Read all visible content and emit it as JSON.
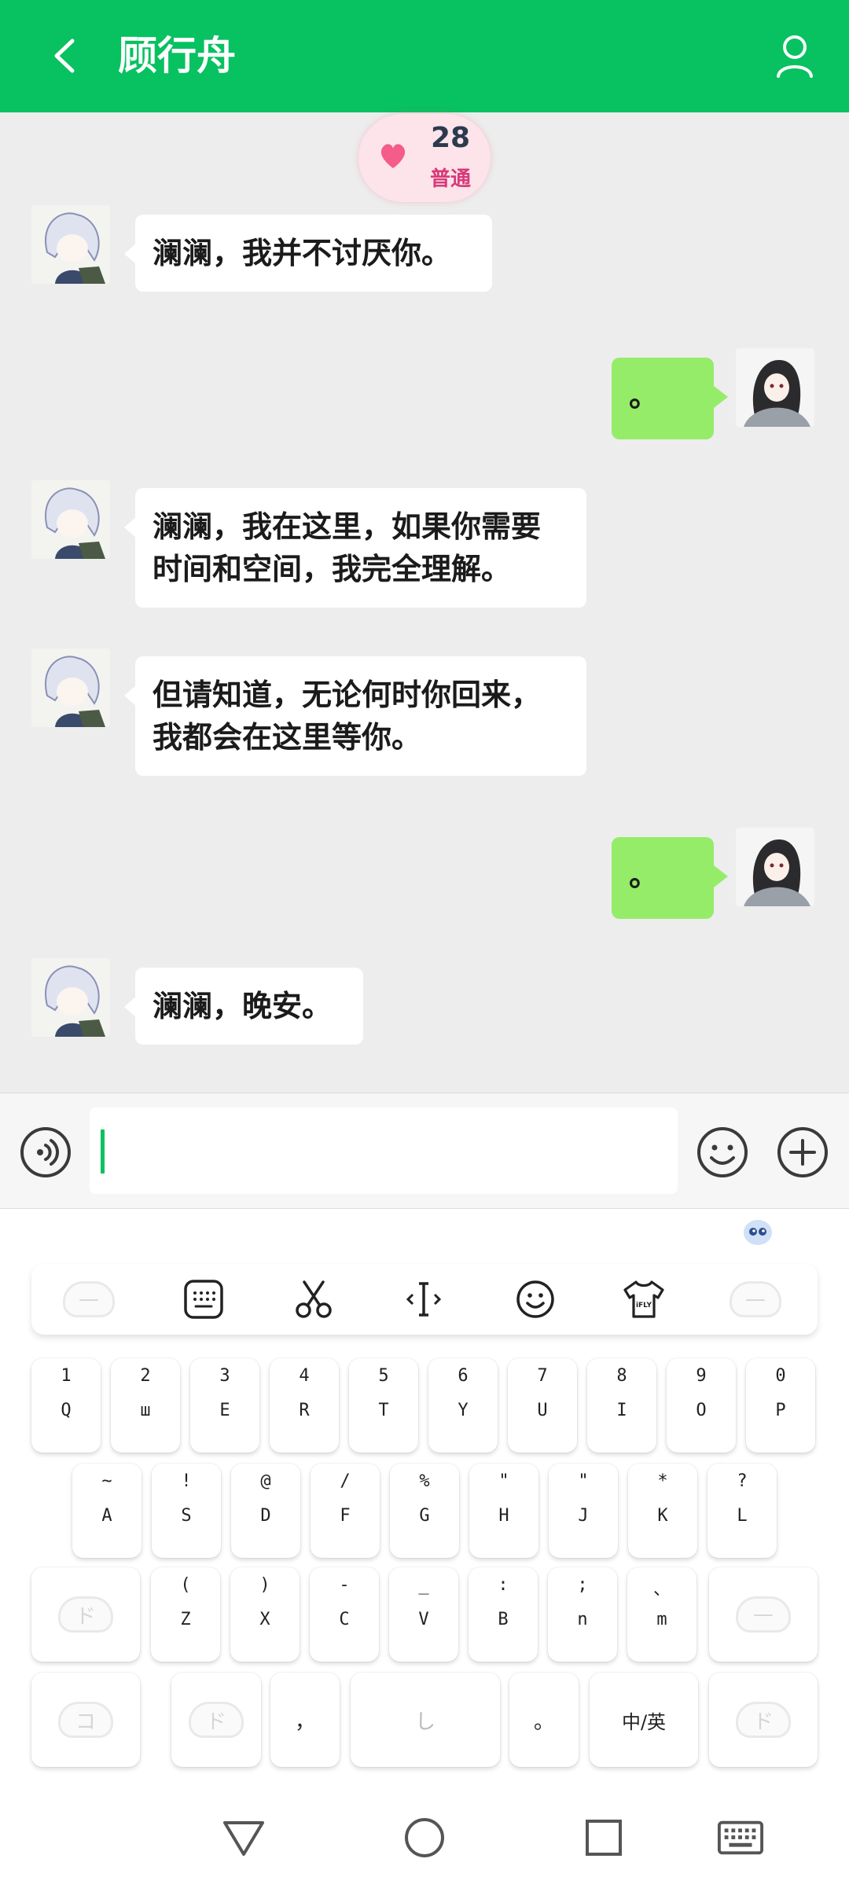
{
  "header": {
    "title": "顾行舟",
    "back_icon": "chevron-left-icon",
    "profile_icon": "user-icon",
    "color": "#08c161"
  },
  "affinity": {
    "value": "28",
    "level": "普通",
    "icon": "heart-icon"
  },
  "messages": [
    {
      "side": "left",
      "text": "澜澜，我并不讨厌你。"
    },
    {
      "side": "right",
      "text": "。"
    },
    {
      "side": "left",
      "text": "澜澜，我在这里，如果你需要时间和空间，我完全理解。"
    },
    {
      "side": "left",
      "text": "但请知道，无论何时你回来，我都会在这里等你。"
    },
    {
      "side": "right",
      "text": "。"
    },
    {
      "side": "left",
      "text": "澜澜，晚安。"
    }
  ],
  "input_bar": {
    "value": "",
    "voice_icon": "voice-icon",
    "emoji_icon": "smiley-icon",
    "plus_icon": "plus-circle-icon"
  },
  "keyboard": {
    "brand_icon": "ifly-assistant-icon",
    "toolbar_icons": [
      "cloud-icon",
      "keyboard-icon",
      "scissors-icon",
      "cursor-icon",
      "smiley-icon",
      "tshirt-icon",
      "cloud-icon"
    ],
    "toolbar_labels": {
      "tshirt": "iFLY"
    },
    "row1": [
      {
        "sup": "1",
        "main": "Q"
      },
      {
        "sup": "2",
        "main": "ш"
      },
      {
        "sup": "3",
        "main": "E"
      },
      {
        "sup": "4",
        "main": "R"
      },
      {
        "sup": "5",
        "main": "T"
      },
      {
        "sup": "6",
        "main": "Y"
      },
      {
        "sup": "7",
        "main": "U"
      },
      {
        "sup": "8",
        "main": "I"
      },
      {
        "sup": "9",
        "main": "O"
      },
      {
        "sup": "0",
        "main": "P"
      }
    ],
    "row2": [
      {
        "sup": "~",
        "main": "A"
      },
      {
        "sup": "!",
        "main": "S"
      },
      {
        "sup": "@",
        "main": "D"
      },
      {
        "sup": "/",
        "main": "F"
      },
      {
        "sup": "%",
        "main": "G"
      },
      {
        "sup": "\"",
        "main": "H"
      },
      {
        "sup": "\"",
        "main": "J"
      },
      {
        "sup": "*",
        "main": "K"
      },
      {
        "sup": "?",
        "main": "L"
      }
    ],
    "row3": [
      {
        "sup": "(",
        "main": "Z"
      },
      {
        "sup": ")",
        "main": "X"
      },
      {
        "sup": "-",
        "main": "C"
      },
      {
        "sup": "_",
        "main": "V"
      },
      {
        "sup": ":",
        "main": "B"
      },
      {
        "sup": ";",
        "main": "n"
      },
      {
        "sup": "、",
        "main": "m"
      }
    ],
    "row3_left_glyph": "ド",
    "row3_right_glyph": "—",
    "row4": {
      "key1": "コ",
      "key2": "ド",
      "comma": "，",
      "space_glyph": "し",
      "period": "。",
      "lang": "中/英",
      "key_last": "ド"
    }
  },
  "navbar": {
    "icons": [
      "back-triangle-icon",
      "home-circle-icon",
      "recents-square-icon",
      "keyboard-toggle-icon"
    ]
  }
}
